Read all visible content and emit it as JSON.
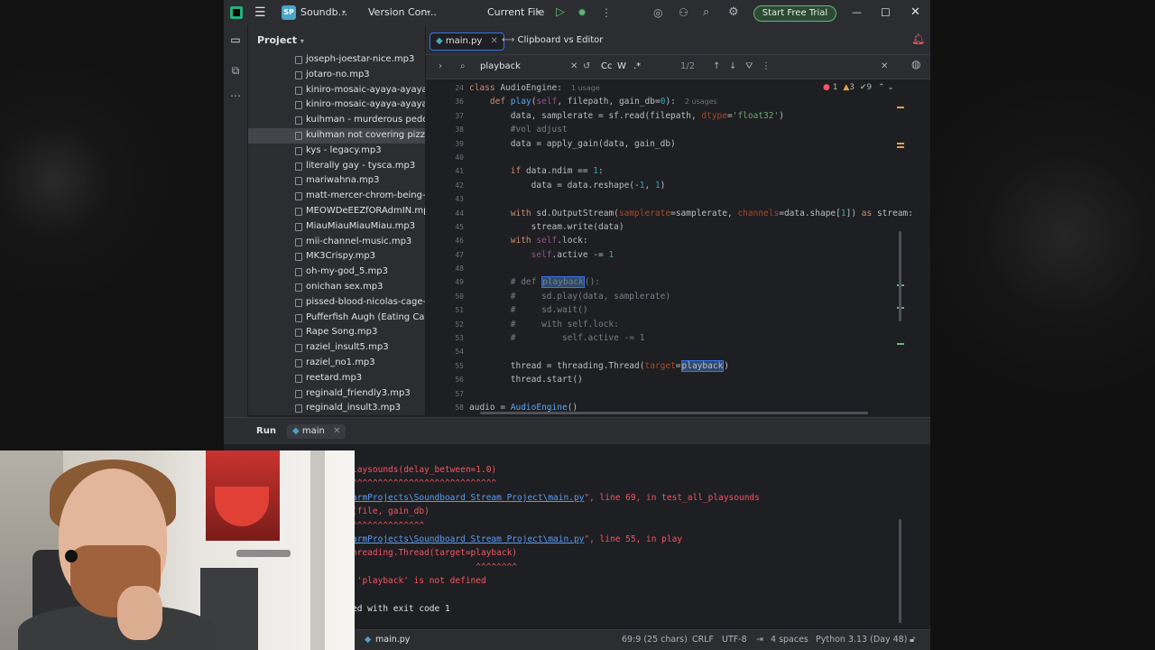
{
  "titlebar": {
    "project_badge": "SP",
    "project_name": "Soundb...",
    "vcs": "Version Con...",
    "run_config": "Current File",
    "trial_button": "Start Free Trial"
  },
  "project_panel": {
    "title": "Project",
    "files": [
      "joseph-joestar-nice.mp3",
      "jotaro-no.mp3",
      "kiniro-mosaic-ayaya-ayaya-ay",
      "kiniro-mosaic-ayaya-ayaya_Hc",
      "kuihman - murderous pedoph",
      "kuihman not covering pizza cl",
      "kys - legacy.mp3",
      "literally gay - tysca.mp3",
      "mariwahna.mp3",
      "matt-mercer-chrom-being-he",
      "MEOWDeEEZfORAdmIN.mp3",
      "MiauMiauMiauMiau.mp3",
      "mii-channel-music.mp3",
      "MK3Crispy.mp3",
      "oh-my-god_5.mp3",
      "onichan sex.mp3",
      "pissed-blood-nicolas-cage-be",
      "Pufferfish Augh (Eating Carrot",
      "Rape Song.mp3",
      "raziel_insult5.mp3",
      "raziel_no1.mp3",
      "reetard.mp3",
      "reginald_friendly3.mp3",
      "reginald_insult3.mp3"
    ],
    "selected_index": 5
  },
  "editor": {
    "tabs": [
      {
        "label": "main.py"
      },
      {
        "label": "Clipboard vs Editor"
      }
    ],
    "search": {
      "query": "playback",
      "match_count": "1/2",
      "case_label": "Cc",
      "word_label": "W",
      "regex_label": ".*"
    },
    "inspections": {
      "errors": "1",
      "warnings": "3",
      "weak": "9"
    },
    "lines": [
      {
        "n": "24",
        "text": "class AudioEngine:",
        "hint": "1 usage",
        "indent": 0
      },
      {
        "n": "36",
        "text": "    def play(self, filepath, gain_db=0):",
        "hint": "2 usages",
        "indent": 0
      },
      {
        "n": "37",
        "text": "        data, samplerate = sf.read(filepath, dtype='float32')",
        "hint": "",
        "indent": 0
      },
      {
        "n": "38",
        "text": "        #vol adjust",
        "hint": "",
        "indent": 0
      },
      {
        "n": "39",
        "text": "        data = apply_gain(data, gain_db)",
        "hint": "",
        "indent": 0
      },
      {
        "n": "40",
        "text": "",
        "hint": "",
        "indent": 0
      },
      {
        "n": "41",
        "text": "        if data.ndim == 1:",
        "hint": "",
        "indent": 0
      },
      {
        "n": "42",
        "text": "            data = data.reshape(-1, 1)",
        "hint": "",
        "indent": 0
      },
      {
        "n": "43",
        "text": "",
        "hint": "",
        "indent": 0
      },
      {
        "n": "44",
        "text": "        with sd.OutputStream(samplerate=samplerate, channels=data.shape[1]) as stream:",
        "hint": "",
        "indent": 0
      },
      {
        "n": "45",
        "text": "            stream.write(data)",
        "hint": "",
        "indent": 0
      },
      {
        "n": "46",
        "text": "        with self.lock:",
        "hint": "",
        "indent": 0
      },
      {
        "n": "47",
        "text": "            self.active -= 1",
        "hint": "",
        "indent": 0
      },
      {
        "n": "48",
        "text": "",
        "hint": "",
        "indent": 0
      },
      {
        "n": "49",
        "text": "        # def playback():",
        "hint": "",
        "indent": 0
      },
      {
        "n": "50",
        "text": "        #     sd.play(data, samplerate)",
        "hint": "",
        "indent": 0
      },
      {
        "n": "51",
        "text": "        #     sd.wait()",
        "hint": "",
        "indent": 0
      },
      {
        "n": "52",
        "text": "        #     with self.lock:",
        "hint": "",
        "indent": 0
      },
      {
        "n": "53",
        "text": "        #         self.active -= 1",
        "hint": "",
        "indent": 0
      },
      {
        "n": "54",
        "text": "",
        "hint": "",
        "indent": 0
      },
      {
        "n": "55",
        "text": "        thread = threading.Thread(target=playback)",
        "hint": "",
        "indent": 0
      },
      {
        "n": "56",
        "text": "        thread.start()",
        "hint": "",
        "indent": 0
      },
      {
        "n": "57",
        "text": "",
        "hint": "",
        "indent": 0
      },
      {
        "n": "58",
        "text": "audio = AudioEngine()",
        "hint": "",
        "indent": 0
      }
    ]
  },
  "run": {
    "title": "Run",
    "tab": "main",
    "console": [
      {
        "text": "laysounds(delay_between=1.0)",
        "cls": "err"
      },
      {
        "text": "^^^^^^^^^^^^^^^^^^^^^^^^^^^^",
        "cls": "err"
      },
      {
        "text": "armProjects\\Soundboard Stream Project\\main.py",
        "suffix": "\", line 69, in test_all_playsounds",
        "cls": "link"
      },
      {
        "text": "(file, gain_db)",
        "cls": "err"
      },
      {
        "text": "^^^^^^^^^^^^^^",
        "cls": "err"
      },
      {
        "text": "armProjects\\Soundboard Stream Project\\main.py",
        "suffix": "\", line 55, in play",
        "cls": "link"
      },
      {
        "text": "hreading.Thread(target=playback)",
        "cls": "err"
      },
      {
        "text": "                        ^^^^^^^^",
        "cls": "err"
      },
      {
        "text": " 'playback' is not defined",
        "cls": "err"
      },
      {
        "text": "",
        "cls": ""
      },
      {
        "text": "ed with exit code 1",
        "cls": "plain"
      }
    ]
  },
  "statusbar": {
    "file": "main.py",
    "position": "69:9 (25 chars)",
    "line_sep": "CRLF",
    "encoding": "UTF-8",
    "indent": "4 spaces",
    "interpreter": "Python 3.13 (Day 48)"
  }
}
